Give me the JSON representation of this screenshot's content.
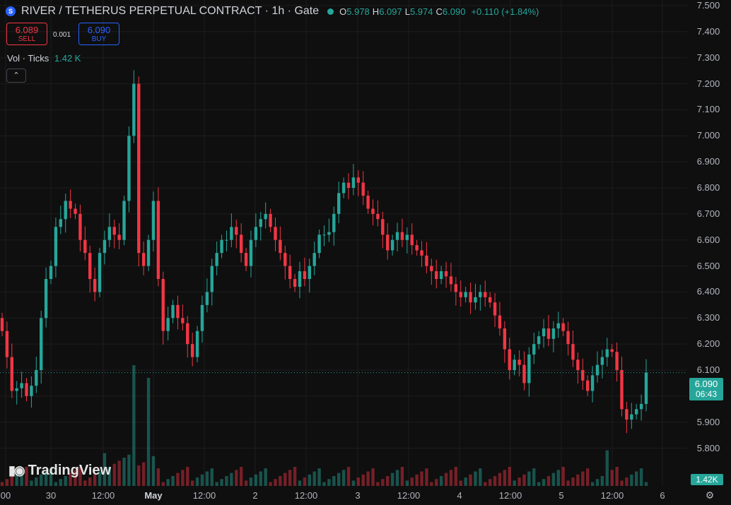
{
  "header": {
    "logo_glyph": "S",
    "title": "RIVER / TETHERUS PERPETUAL CONTRACT · 1h · Gate",
    "ohlc": [
      {
        "k": "O",
        "v": "5.978"
      },
      {
        "k": "H",
        "v": "6.097"
      },
      {
        "k": "L",
        "v": "5.974"
      },
      {
        "k": "C",
        "v": "6.090"
      }
    ],
    "change": "+0.110 (+1.84%)"
  },
  "trade": {
    "sell_price": "6.089",
    "sell_label": "SELL",
    "spread": "0.001",
    "buy_price": "6.090",
    "buy_label": "BUY"
  },
  "volume": {
    "label": "Vol · Ticks",
    "value": "1.42 K"
  },
  "collapse_icon": "chevron-up-icon",
  "price_scale": [
    "7.500",
    "7.400",
    "7.300",
    "7.200",
    "7.100",
    "7.000",
    "6.900",
    "6.800",
    "6.700",
    "6.600",
    "6.500",
    "6.400",
    "6.300",
    "6.200",
    "6.100",
    "6.000",
    "5.900",
    "5.800"
  ],
  "time_scale": [
    {
      "t": "00",
      "bold": false
    },
    {
      "t": "30",
      "bold": false
    },
    {
      "t": "12:00",
      "bold": false
    },
    {
      "t": "May",
      "bold": true
    },
    {
      "t": "12:00",
      "bold": false
    },
    {
      "t": "2",
      "bold": false
    },
    {
      "t": "12:00",
      "bold": false
    },
    {
      "t": "3",
      "bold": false
    },
    {
      "t": "12:00",
      "bold": false
    },
    {
      "t": "4",
      "bold": false
    },
    {
      "t": "12:00",
      "bold": false
    },
    {
      "t": "5",
      "bold": false
    },
    {
      "t": "12:00",
      "bold": false
    },
    {
      "t": "6",
      "bold": false
    }
  ],
  "last_price": {
    "price": "6.090",
    "countdown": "06:43"
  },
  "volume_tag": "1.42K",
  "watermark": "TradingView",
  "settings_icon": "gear-icon",
  "colors": {
    "up": "#26a69a",
    "down": "#f23645",
    "background": "#0f0f0f",
    "grid": "#1e1e1e"
  },
  "chart_data": {
    "type": "candlestick",
    "interval": "1h",
    "y_range": [
      5.75,
      7.5
    ],
    "last_close": 6.09,
    "closes": [
      6.25,
      6.15,
      6.02,
      6.03,
      6.05,
      6.0,
      6.04,
      6.1,
      6.3,
      6.45,
      6.5,
      6.65,
      6.68,
      6.75,
      6.72,
      6.7,
      6.6,
      6.55,
      6.45,
      6.4,
      6.55,
      6.6,
      6.65,
      6.62,
      6.6,
      6.75,
      7.0,
      7.2,
      6.55,
      6.5,
      6.6,
      6.75,
      6.45,
      6.25,
      6.3,
      6.35,
      6.3,
      6.28,
      6.2,
      6.15,
      6.25,
      6.35,
      6.4,
      6.5,
      6.55,
      6.6,
      6.6,
      6.65,
      6.62,
      6.55,
      6.5,
      6.6,
      6.65,
      6.68,
      6.7,
      6.65,
      6.6,
      6.55,
      6.5,
      6.45,
      6.42,
      6.48,
      6.45,
      6.5,
      6.55,
      6.62,
      6.62,
      6.63,
      6.7,
      6.78,
      6.82,
      6.8,
      6.84,
      6.82,
      6.77,
      6.72,
      6.7,
      6.68,
      6.62,
      6.56,
      6.6,
      6.63,
      6.6,
      6.62,
      6.58,
      6.56,
      6.54,
      6.5,
      6.48,
      6.45,
      6.48,
      6.46,
      6.43,
      6.4,
      6.38,
      6.4,
      6.36,
      6.38,
      6.4,
      6.38,
      6.36,
      6.31,
      6.26,
      6.18,
      6.1,
      6.14,
      6.12,
      6.05,
      6.16,
      6.2,
      6.23,
      6.26,
      6.22,
      6.26,
      6.28,
      6.25,
      6.2,
      6.14,
      6.1,
      6.06,
      6.02,
      6.08,
      6.12,
      6.15,
      6.18,
      6.17,
      6.1,
      5.95,
      5.91,
      5.93,
      5.95,
      5.97,
      6.09
    ],
    "volume_peaks": [
      {
        "bar": 27,
        "level": 0.95
      },
      {
        "bar": 30,
        "level": 0.85
      },
      {
        "bar": 124,
        "level": 0.28
      }
    ],
    "volume_unit": "K"
  }
}
